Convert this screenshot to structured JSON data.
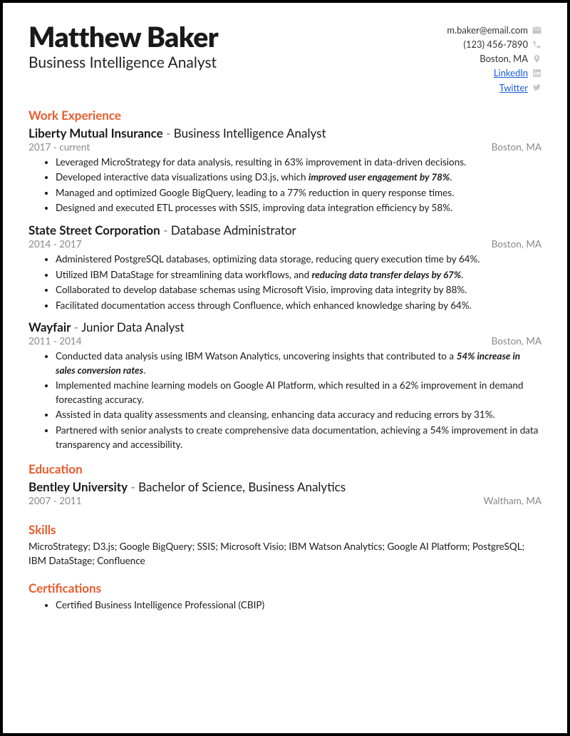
{
  "header": {
    "name": "Matthew Baker",
    "title": "Business Intelligence Analyst",
    "contact": {
      "email": "m.baker@email.com",
      "phone": "(123) 456-7890",
      "location": "Boston, MA",
      "linkedin": "LinkedIn",
      "twitter": "Twitter"
    }
  },
  "sections": {
    "work": "Work Experience",
    "education": "Education",
    "skills": "Skills",
    "certs": "Certifications"
  },
  "jobs": [
    {
      "company": "Liberty Mutual Insurance",
      "role": "Business Intelligence Analyst",
      "dates": "2017 - current",
      "location": "Boston, MA",
      "bullets": [
        {
          "pre": "Leveraged MicroStrategy for data analysis, resulting in 63% improvement in data-driven decisions.",
          "em": "",
          "post": ""
        },
        {
          "pre": "Developed interactive data visualizations using D3.js, which ",
          "em": "improved user engagement by 78%",
          "post": "."
        },
        {
          "pre": "Managed and optimized Google BigQuery, leading to a 77% reduction in query response times.",
          "em": "",
          "post": ""
        },
        {
          "pre": "Designed and executed ETL processes with SSIS, improving data integration efficiency by 58%.",
          "em": "",
          "post": ""
        }
      ]
    },
    {
      "company": "State Street Corporation",
      "role": "Database Administrator",
      "dates": "2014 - 2017",
      "location": "Boston, MA",
      "bullets": [
        {
          "pre": "Administered PostgreSQL databases, optimizing data storage, reducing query execution time by 64%.",
          "em": "",
          "post": ""
        },
        {
          "pre": "Utilized IBM DataStage for streamlining data workflows, and ",
          "em": "reducing data transfer delays by 67%",
          "post": "."
        },
        {
          "pre": "Collaborated to develop database schemas using Microsoft Visio, improving data integrity by 88%.",
          "em": "",
          "post": ""
        },
        {
          "pre": "Facilitated documentation access through Confluence, which enhanced knowledge sharing by 64%.",
          "em": "",
          "post": ""
        }
      ]
    },
    {
      "company": "Wayfair",
      "role": "Junior Data Analyst",
      "dates": "2011 - 2014",
      "location": "Boston, MA",
      "bullets": [
        {
          "pre": "Conducted data analysis using IBM Watson Analytics, uncovering insights that contributed to a ",
          "em": "54% increase in sales conversion rates",
          "post": "."
        },
        {
          "pre": "Implemented machine learning models on Google AI Platform, which resulted in a 62% improvement in demand forecasting accuracy.",
          "em": "",
          "post": ""
        },
        {
          "pre": "Assisted in data quality assessments and cleansing, enhancing data accuracy and reducing errors by 31%.",
          "em": "",
          "post": ""
        },
        {
          "pre": "Partnered with senior analysts to create comprehensive data documentation, achieving a 54% improvement in data transparency and accessibility.",
          "em": "",
          "post": ""
        }
      ]
    }
  ],
  "education": {
    "school": "Bentley University",
    "degree": "Bachelor of Science,",
    "field": "Business Analytics",
    "dates": "2007 - 2011",
    "location": "Waltham, MA"
  },
  "skills": "MicroStrategy; D3.js; Google BigQuery; SSIS; Microsoft Visio; IBM Watson Analytics; Google AI Platform; PostgreSQL; IBM DataStage; Confluence",
  "certs": [
    "Certified Business Intelligence Professional (CBIP)"
  ]
}
